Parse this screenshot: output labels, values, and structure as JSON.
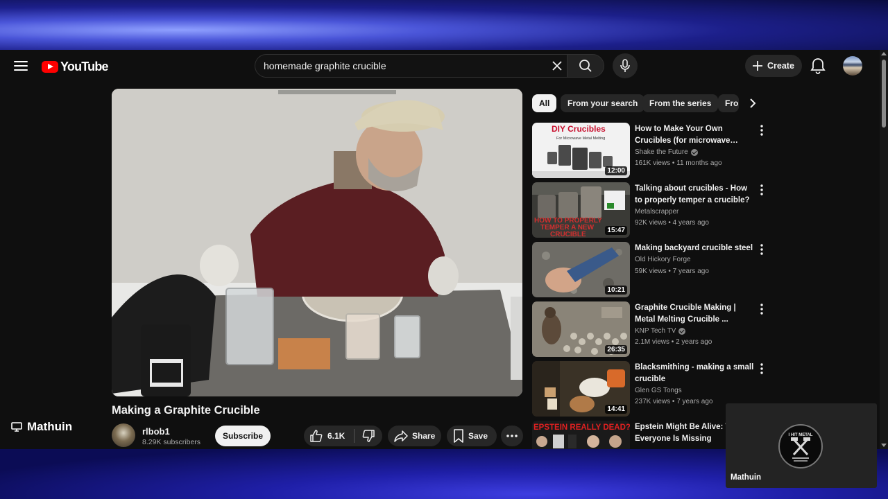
{
  "header": {
    "logo_text": "YouTube",
    "search_value": "homemade graphite crucible",
    "create_label": "Create"
  },
  "video": {
    "title": "Making a Graphite Crucible",
    "channel": "rlbob1",
    "subscribers": "8.29K subscribers",
    "subscribe_label": "Subscribe",
    "likes": "6.1K",
    "share_label": "Share",
    "save_label": "Save"
  },
  "chips": [
    "All",
    "From your search",
    "From the series",
    "Fro"
  ],
  "recommended": [
    {
      "title": "How to Make Your Own Crucibles (for microwave meta…",
      "channel": "Shake the Future",
      "verified": true,
      "meta": "161K views • 11 months ago",
      "duration": "12:00",
      "thumb_text_1": "DIY Crucibles",
      "thumb_text_2": "For Microwave Metal Melting"
    },
    {
      "title": "Talking about crucibles - How to properly temper a crucible?",
      "channel": "Metalscrapper",
      "verified": false,
      "meta": "92K views • 4 years ago",
      "duration": "15:47",
      "thumb_text_1": "HOW TO PROPERLY",
      "thumb_text_2": "TEMPER A NEW",
      "thumb_text_3": "CRUCIBLE"
    },
    {
      "title": "Making backyard crucible steel",
      "channel": "Old Hickory Forge",
      "verified": false,
      "meta": "59K views • 7 years ago",
      "duration": "10:21"
    },
    {
      "title": "Graphite Crucible Making | Metal Melting Crucible ...",
      "channel": "KNP Tech TV",
      "verified": true,
      "meta": "2.1M views • 2 years ago",
      "duration": "26:35"
    },
    {
      "title": "Blacksmithing - making a small crucible",
      "channel": "Glen GS Tongs",
      "verified": false,
      "meta": "237K views • 7 years ago",
      "duration": "14:41"
    },
    {
      "title": "Epstein Might Be Alive: W… Everyone Is Missing",
      "channel": "",
      "verified": false,
      "meta": "",
      "duration": "",
      "thumb_text_1": "EPSTEIN REALLY DEAD?"
    }
  ],
  "overlay": {
    "stream_name": "Mathuin",
    "cam_name": "Mathuin",
    "badge_text": "I HIT METAL"
  },
  "colors": {
    "accent": "#ff0000",
    "background": "#0f0f0f",
    "chip_active": "#f1f1f1"
  }
}
